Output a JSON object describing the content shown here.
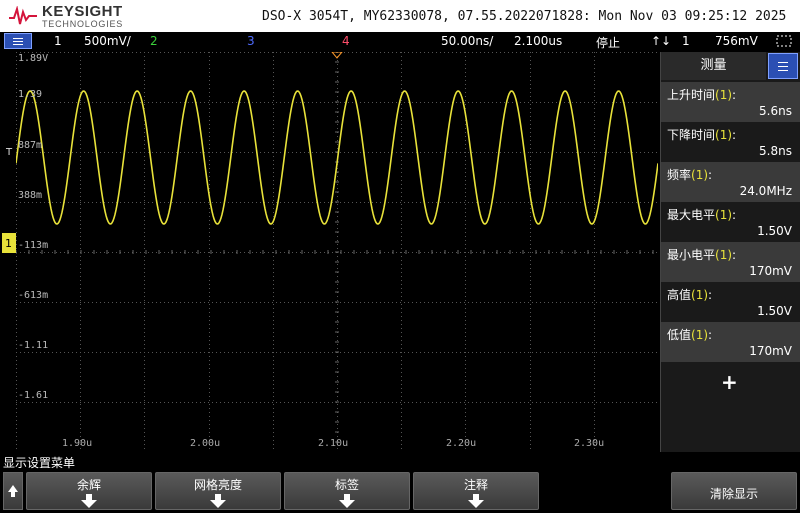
{
  "brand": {
    "name": "KEYSIGHT",
    "sub": "TECHNOLOGIES"
  },
  "title": "DSO-X 3054T, MY62330078, 07.55.2022071828: Mon Nov 03 09:25:12 2025",
  "status": {
    "ch1_num": "1",
    "ch1_scale": "500mV/",
    "ch2_num": "2",
    "ch3_num": "3",
    "ch4_num": "4",
    "timebase": "50.00ns/",
    "delay": "2.100us",
    "run_state": "停止",
    "trig_icon": "↑↓",
    "trig_source": "1",
    "trig_level": "756mV",
    "colors": {
      "ch1": "#e8e23a",
      "ch2": "#3bd13b",
      "ch3": "#4f6bff",
      "ch4": "#ff4d6a"
    }
  },
  "y_axis_labels": [
    "1.89V",
    "1.39",
    "887m",
    "388m",
    "-113m",
    "-613m",
    "-1.11",
    "-1.61"
  ],
  "x_axis_labels": [
    "1.90u",
    "2.00u",
    "2.10u",
    "2.20u",
    "2.30u"
  ],
  "markers": {
    "trigger_label": "T"
  },
  "measure_panel": {
    "header": "测量",
    "items": [
      {
        "name": "上升时间",
        "ch": "(1)",
        "colon": ":",
        "value": "5.6ns"
      },
      {
        "name": "下降时间",
        "ch": "(1)",
        "colon": ":",
        "value": "5.8ns"
      },
      {
        "name": "频率",
        "ch": "(1)",
        "colon": ":",
        "value": "24.0MHz"
      },
      {
        "name": "最大电平",
        "ch": "(1)",
        "colon": ":",
        "value": "1.50V"
      },
      {
        "name": "最小电平",
        "ch": "(1)",
        "colon": ":",
        "value": "170mV"
      },
      {
        "name": "高值",
        "ch": "(1)",
        "colon": ":",
        "value": "1.50V"
      },
      {
        "name": "低值",
        "ch": "(1)",
        "colon": ":",
        "value": "170mV"
      }
    ],
    "add_label": "+"
  },
  "softkeys": {
    "menu_title": "显示设置菜单",
    "keys": [
      "余辉",
      "网格亮度",
      "标签",
      "注释"
    ],
    "clear": "清除显示"
  },
  "waveform": {
    "high_v": 1.5,
    "low_v": 0.17,
    "frequency_mhz": 24.0,
    "channel": "1"
  }
}
